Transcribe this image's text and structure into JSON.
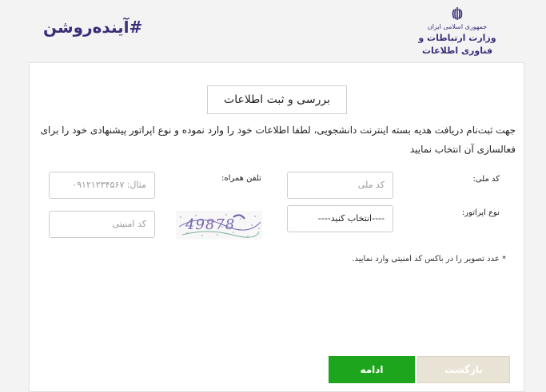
{
  "header": {
    "slogan": "#آینده‌روشن",
    "logo_top": "جمهوری اسلامی ایران",
    "logo_main": "وزارت ارتباطات و فناوری اطلاعات"
  },
  "form": {
    "title": "بررسی و ثبت اطلاعات",
    "intro": "جهت ثبت‌نام دریافت هدیه بسته اینترنت دانشجویی، لطفا اطلاعات خود را وارد نموده و نوع اپراتور پیشنهادی خود را برای فعالسازی آن انتخاب نمایید",
    "national_code_label": "کد ملی:",
    "national_code_placeholder": "کد ملی",
    "phone_label": "تلفن همراه:",
    "phone_placeholder": "مثال: ۰۹۱۲۱۲۳۴۵۶۷",
    "operator_label": "نوع اپراتور:",
    "operator_selected": "----انتخاب کنید----",
    "captcha_text": "49878",
    "security_code_placeholder": "کد امنیتی",
    "note": "* عدد تصویر را در باکس کد امنیتی وارد نمایید."
  },
  "buttons": {
    "continue": "ادامه",
    "back": "بازگشت"
  },
  "colors": {
    "brand": "#3b2f7a",
    "continue_button": "#1ea51e",
    "back_button": "#e9e3d6"
  }
}
